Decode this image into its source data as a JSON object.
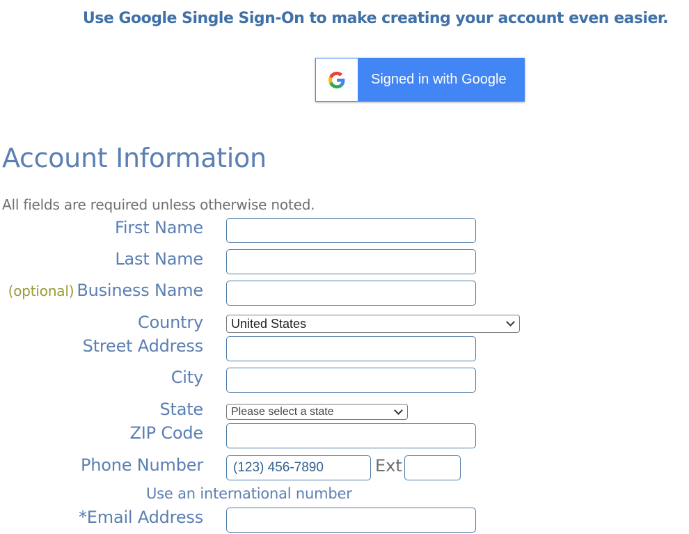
{
  "sso": {
    "headline": "Use Google Single Sign-On to make creating your account even easier.",
    "google_button_label": "Signed in with Google",
    "google_icon": "google-g-icon"
  },
  "account": {
    "title": "Account Information",
    "required_note": "All fields are required unless otherwise noted."
  },
  "fields": {
    "first_name": {
      "label": "First Name",
      "value": ""
    },
    "last_name": {
      "label": "Last Name",
      "value": ""
    },
    "business_name": {
      "optional_tag": "(optional)",
      "label": "Business Name",
      "value": ""
    },
    "country": {
      "label": "Country",
      "selected": "United States"
    },
    "street_address": {
      "label": "Street Address",
      "value": ""
    },
    "city": {
      "label": "City",
      "value": ""
    },
    "state": {
      "label": "State",
      "selected": "Please select a state"
    },
    "zip": {
      "label": "ZIP Code",
      "value": ""
    },
    "phone": {
      "label": "Phone Number",
      "placeholder": "(123) 456-7890",
      "ext_label": "Ext",
      "ext_value": ""
    },
    "international_link": "Use an international number",
    "email": {
      "label": "*Email Address",
      "value": ""
    }
  },
  "colors": {
    "google_blue": "#4285f4",
    "label_blue": "#5b7fb3",
    "headline_blue": "#3f70a6",
    "optional_olive": "#9a9a33",
    "input_border": "#4d7aa3"
  }
}
